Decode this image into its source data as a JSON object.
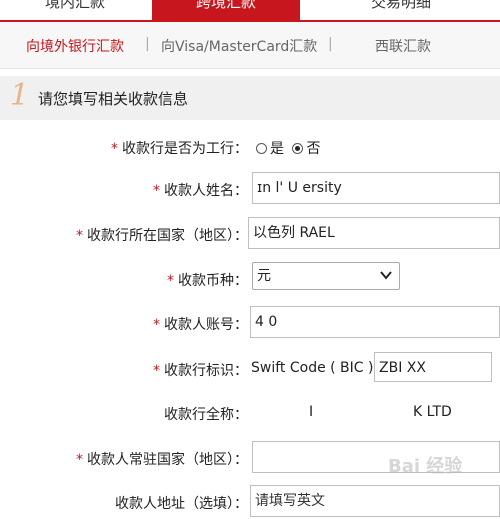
{
  "top_tabs": {
    "t1": "境内汇款",
    "t2": "跨境汇款",
    "t3": "交易明细"
  },
  "sub_tabs": {
    "s1": "向境外银行汇款",
    "s2": "向Visa/MasterCard汇款",
    "s3": "西联汇款"
  },
  "section": {
    "step": "1",
    "title": "请您填写相关收款信息"
  },
  "form": {
    "payee_bank_is_icbc": {
      "label": "收款行是否为工行：",
      "opt_yes": "是",
      "opt_no": "否"
    },
    "payee_name": {
      "label": "收款人姓名：",
      "value": "ɪn l' U  ersity"
    },
    "country": {
      "label": "收款行所在国家（地区）：",
      "value": "以色列  RAEL"
    },
    "currency": {
      "label": "收款币种：",
      "value": "元"
    },
    "account": {
      "label": "收款人账号：",
      "value": "4  0"
    },
    "bank_id": {
      "label": "收款行标识：",
      "prefix": "Swift Code ( BIC )",
      "value": "ZBI  XX"
    },
    "bank_fullname": {
      "label": "收款行全称：",
      "value_a": "I",
      "value_b": "K LTD"
    },
    "residence_country": {
      "label": "收款人常驻国家（地区）：",
      "value": ""
    },
    "address": {
      "label": "收款人地址（选填）：",
      "value": "请填写英文"
    }
  },
  "watermark": "Bai 经验",
  "colors": {
    "accent": "#c8161e",
    "required": "#c8161e"
  }
}
